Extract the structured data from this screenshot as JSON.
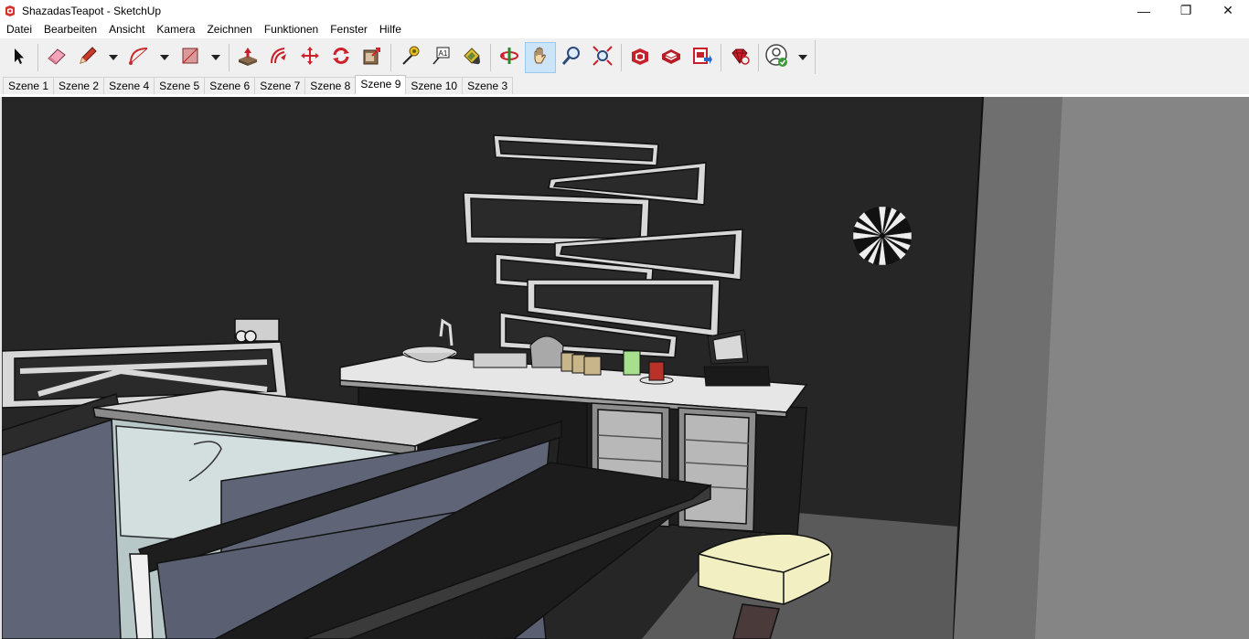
{
  "window": {
    "title": "ShazadasTeapot - SketchUp",
    "app_icon": "sketchup-logo-icon",
    "controls": {
      "minimize": "—",
      "restore": "❐",
      "close": "✕"
    }
  },
  "menu": {
    "items": [
      "Datei",
      "Bearbeiten",
      "Ansicht",
      "Kamera",
      "Zeichnen",
      "Funktionen",
      "Fenster",
      "Hilfe"
    ]
  },
  "toolbar": {
    "tools": [
      {
        "name": "select-icon"
      },
      {
        "name": "eraser-icon"
      },
      {
        "name": "pencil-icon",
        "dropdown": true
      },
      {
        "name": "arc-icon",
        "dropdown": true
      },
      {
        "name": "rectangle-icon",
        "dropdown": true
      },
      {
        "name": "push-pull-icon"
      },
      {
        "name": "offset-icon"
      },
      {
        "name": "move-icon"
      },
      {
        "name": "rotate-icon"
      },
      {
        "name": "scale-icon"
      },
      {
        "name": "tape-measure-icon"
      },
      {
        "name": "text-label-icon",
        "label": "A1"
      },
      {
        "name": "paint-bucket-icon"
      },
      {
        "name": "orbit-icon"
      },
      {
        "name": "pan-icon",
        "active": true
      },
      {
        "name": "zoom-icon"
      },
      {
        "name": "zoom-extents-icon"
      },
      {
        "name": "warehouse-icon"
      },
      {
        "name": "extension-warehouse-icon"
      },
      {
        "name": "layout-send-icon"
      },
      {
        "name": "ruby-extension-icon"
      },
      {
        "name": "account-icon",
        "dropdown": true
      }
    ],
    "accent": "#cce4f7"
  },
  "scenes": {
    "tabs": [
      "Szene 1",
      "Szene 2",
      "Szene 4",
      "Szene 5",
      "Szene 6",
      "Szene 7",
      "Szene 8",
      "Szene 9",
      "Szene 10",
      "Szene 3"
    ],
    "active": "Szene 9"
  },
  "colors": {
    "wall_dark": "#252525",
    "side_wall": "#6e6e6e",
    "counter_top": "#e8e8e8",
    "stool_seat": "#f2f0c2",
    "panel_blue": "#5f6577"
  }
}
